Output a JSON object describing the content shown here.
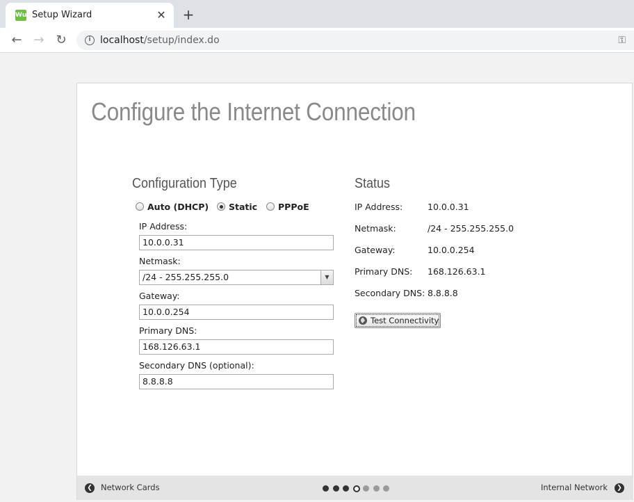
{
  "browser": {
    "tab_title": "Setup Wizard",
    "favicon_text": "Wu",
    "url_host": "localhost",
    "url_path": "/setup/index.do"
  },
  "page": {
    "title": "Configure the Internet Connection"
  },
  "config": {
    "section_title": "Configuration Type",
    "types": [
      {
        "label": "Auto (DHCP)",
        "checked": false
      },
      {
        "label": "Static",
        "checked": true
      },
      {
        "label": "PPPoE",
        "checked": false
      }
    ],
    "fields": {
      "ip_label": "IP Address:",
      "ip_value": "10.0.0.31",
      "netmask_label": "Netmask:",
      "netmask_value": "/24 - 255.255.255.0",
      "gateway_label": "Gateway:",
      "gateway_value": "10.0.0.254",
      "primary_dns_label": "Primary DNS:",
      "primary_dns_value": "168.126.63.1",
      "secondary_dns_label": "Secondary DNS (optional):",
      "secondary_dns_value": "8.8.8.8"
    }
  },
  "status": {
    "section_title": "Status",
    "rows": [
      {
        "label": "IP Address:",
        "value": "10.0.0.31"
      },
      {
        "label": "Netmask:",
        "value": "/24 - 255.255.255.0"
      },
      {
        "label": "Gateway:",
        "value": "10.0.0.254"
      },
      {
        "label": "Primary DNS:",
        "value": "168.126.63.1"
      },
      {
        "label": "Secondary DNS:",
        "value": "8.8.8.8"
      }
    ],
    "test_button": "Test Connectivity"
  },
  "footer": {
    "prev_label": "Network Cards",
    "next_label": "Internal Network",
    "steps_total": 7,
    "current_step": 4
  }
}
